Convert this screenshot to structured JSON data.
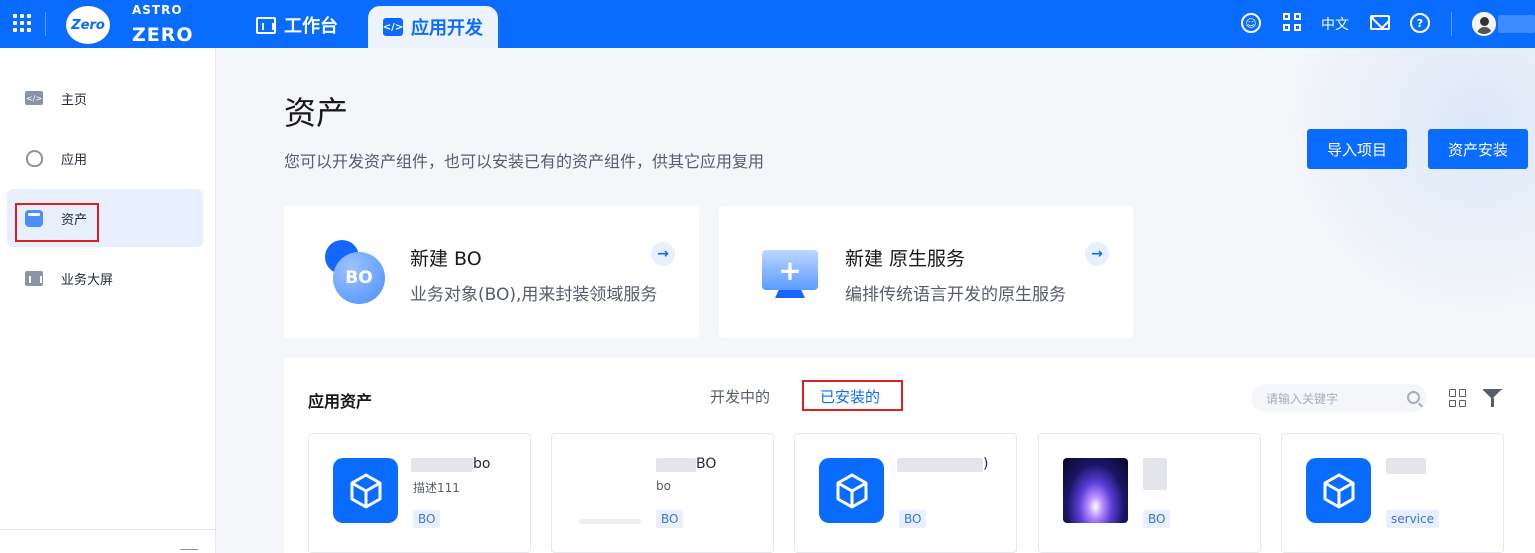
{
  "header": {
    "logo_badge": "Zero",
    "logo_top": "ASTRO",
    "logo_bottom": "ZERO",
    "tabs": [
      {
        "label": "工作台",
        "active": false
      },
      {
        "label": "应用开发",
        "active": true
      }
    ],
    "language": "中文",
    "accent_color": "#0a6cff"
  },
  "sidebar": {
    "items": [
      {
        "label": "主页",
        "icon": "code-window-icon",
        "active": false
      },
      {
        "label": "应用",
        "icon": "app-icon",
        "active": false
      },
      {
        "label": "资产",
        "icon": "asset-icon",
        "active": true
      },
      {
        "label": "业务大屏",
        "icon": "dashboard-icon",
        "active": false
      }
    ]
  },
  "main": {
    "title": "资产",
    "description": "您可以开发资产组件，也可以安装已有的资产组件，供其它应用复用",
    "buttons": {
      "import": "导入项目",
      "install": "资产安装"
    },
    "create_cards": [
      {
        "title": "新建 BO",
        "desc": "业务对象(BO),用来封装领域服务",
        "icon_text": "BO"
      },
      {
        "title": "新建 原生服务",
        "desc": "编排传统语言开发的原生服务",
        "icon_text": "+"
      }
    ],
    "assets_panel": {
      "title": "应用资产",
      "tabs": [
        {
          "label": "开发中的",
          "active": false
        },
        {
          "label": "已安装的",
          "active": true
        }
      ],
      "search_placeholder": "请输入关键字",
      "cards": [
        {
          "name_visible": "bo",
          "desc": "描述111",
          "tag": "BO"
        },
        {
          "name_visible": "BO",
          "desc": "bo",
          "tag": "BO"
        },
        {
          "name_visible": ")",
          "desc": "",
          "tag": "BO"
        },
        {
          "name_visible": "",
          "desc": "",
          "tag": "BO"
        },
        {
          "name_visible": "",
          "desc": "",
          "tag": "service"
        }
      ]
    }
  }
}
